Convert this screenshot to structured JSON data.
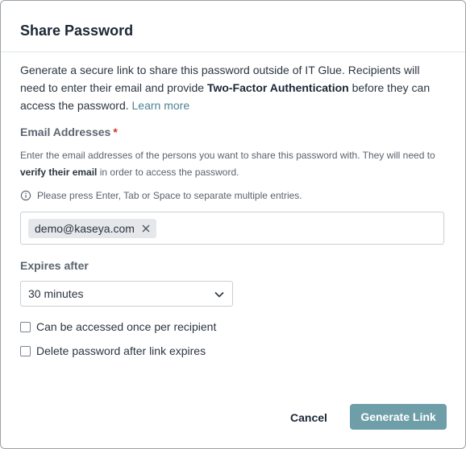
{
  "dialog": {
    "title": "Share Password"
  },
  "intro": {
    "text_before": "Generate a secure link to share this password outside of IT Glue. Recipients will need to enter their email and provide ",
    "bold": "Two-Factor Authentication",
    "text_after": " before they can access the password. ",
    "link": "Learn more"
  },
  "email": {
    "label": "Email Addresses",
    "required_mark": "*",
    "help_before": "Enter the email addresses of the persons you want to share this password with. They will need to ",
    "help_bold": "verify their email",
    "help_after": " in order to access the password.",
    "hint": "Please press Enter, Tab or Space to separate multiple entries.",
    "hint_icon": "info-icon",
    "chips": [
      "demo@kaseya.com"
    ],
    "chip_remove_icon": "close-icon"
  },
  "expires": {
    "label": "Expires after",
    "selected": "30 minutes",
    "dropdown_icon": "chevron-down-icon"
  },
  "options": {
    "once_per_recipient": {
      "label": "Can be accessed once per recipient",
      "checked": false
    },
    "delete_after_expire": {
      "label": "Delete password after link expires",
      "checked": false
    }
  },
  "actions": {
    "cancel_label": "Cancel",
    "generate_label": "Generate Link"
  },
  "colors": {
    "primary_button": "#6e9ea8",
    "link": "#4d8292",
    "required": "#d0342c"
  }
}
